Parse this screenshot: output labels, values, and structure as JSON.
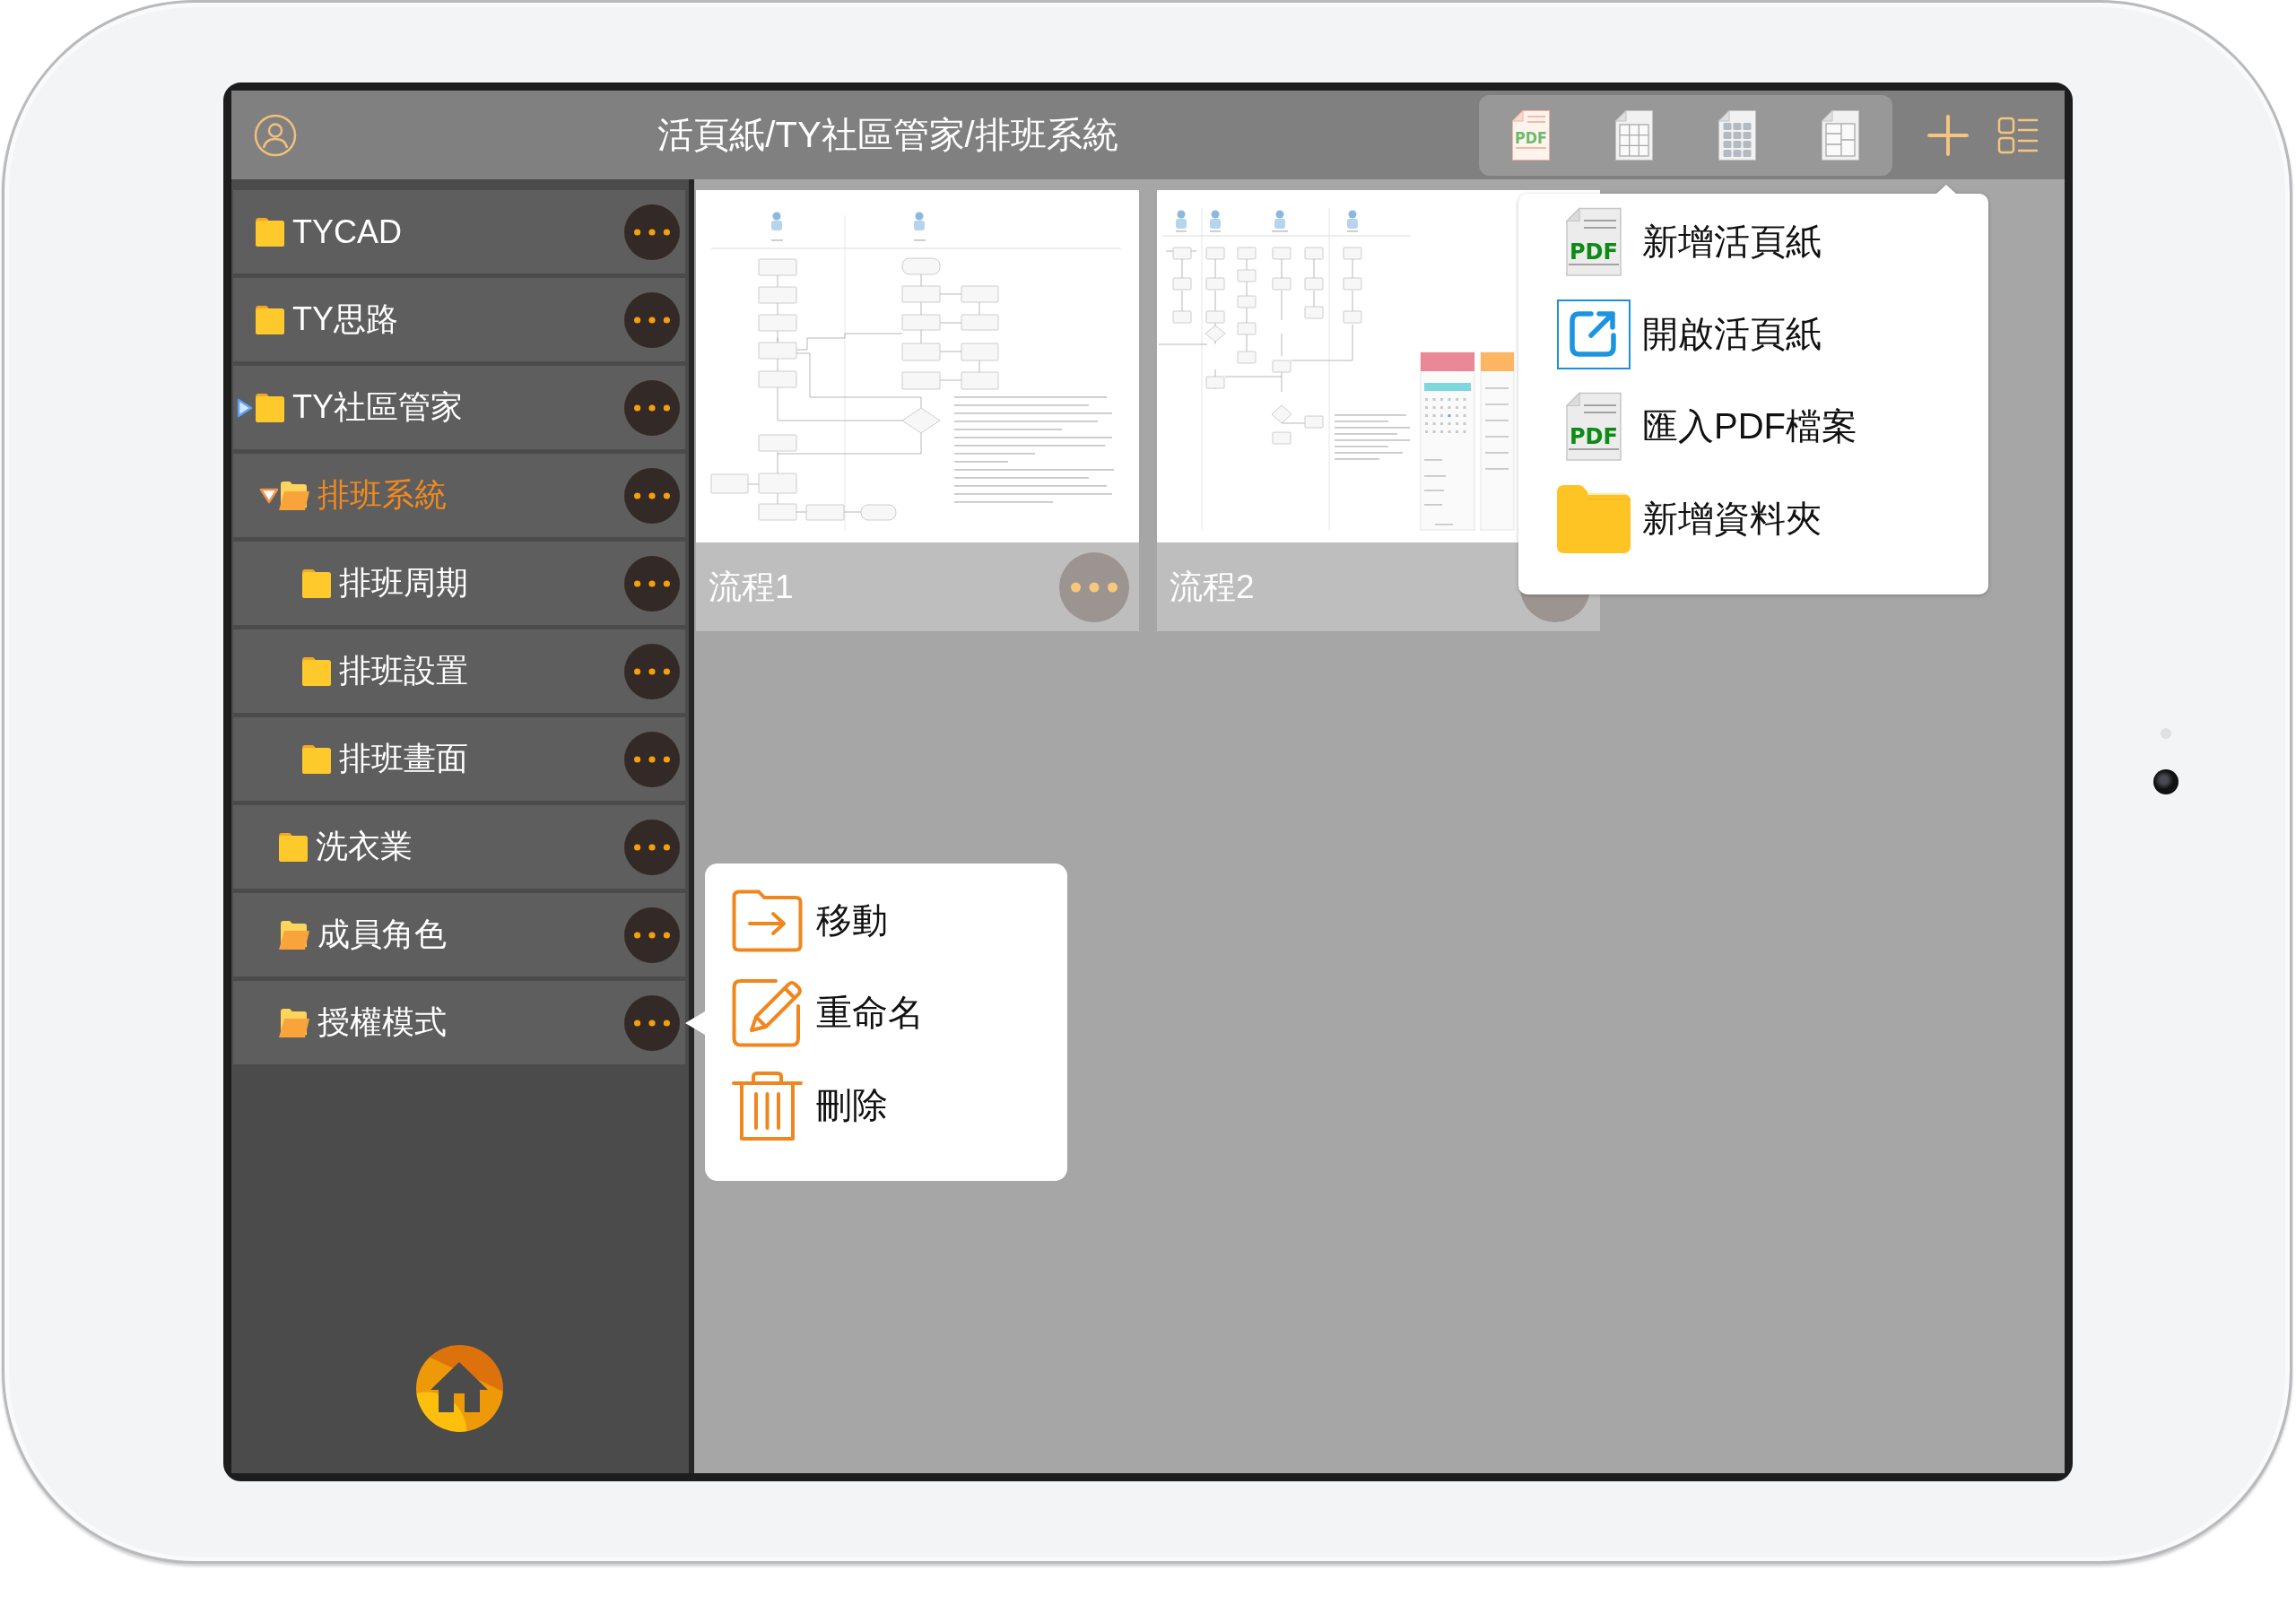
{
  "window": {
    "title": "活頁紙/TY社區管家/排班系統"
  },
  "toolbar": {
    "buttons": [
      {
        "kind": "pdf",
        "badge": "PDF"
      },
      {
        "kind": "grid"
      },
      {
        "kind": "tiles"
      },
      {
        "kind": "layout"
      }
    ]
  },
  "sidebar": {
    "items": [
      {
        "name": "TYCAD",
        "kind": "folder",
        "selected": false
      },
      {
        "name": "TY思路",
        "kind": "folder",
        "selected": false
      },
      {
        "name": "TY社區管家",
        "kind": "folder",
        "selected": false,
        "expanded": false,
        "children": [
          {
            "name": "排班系統",
            "kind": "open-folder",
            "selected": true,
            "expanded": true,
            "children": [
              {
                "name": "排班周期",
                "kind": "folder",
                "selected": false
              },
              {
                "name": "排班設置",
                "kind": "folder",
                "selected": false
              },
              {
                "name": "排班畫面",
                "kind": "folder",
                "selected": false
              }
            ]
          },
          {
            "name": "洗衣業",
            "kind": "folder",
            "selected": false
          },
          {
            "name": "成員角色",
            "kind": "open-folder",
            "selected": false
          },
          {
            "name": "授權模式",
            "kind": "open-folder",
            "selected": false
          }
        ]
      }
    ]
  },
  "documents": [
    {
      "name": "流程1",
      "kind": "flowchart"
    },
    {
      "name": "流程2",
      "kind": "flowchart-with-screens"
    }
  ],
  "add_menu": {
    "items": [
      {
        "kind": "pdf",
        "badge": "PDF",
        "label": "新增活頁紙"
      },
      {
        "kind": "open",
        "label": "開啟活頁紙"
      },
      {
        "kind": "pdf",
        "badge": "PDF",
        "label": "匯入PDF檔案"
      },
      {
        "kind": "folder",
        "label": "新增資料夾"
      }
    ]
  },
  "context_menu": {
    "items": [
      {
        "kind": "move",
        "label": "移動"
      },
      {
        "kind": "rename",
        "label": "重命名"
      },
      {
        "kind": "delete",
        "label": "刪除"
      }
    ]
  }
}
